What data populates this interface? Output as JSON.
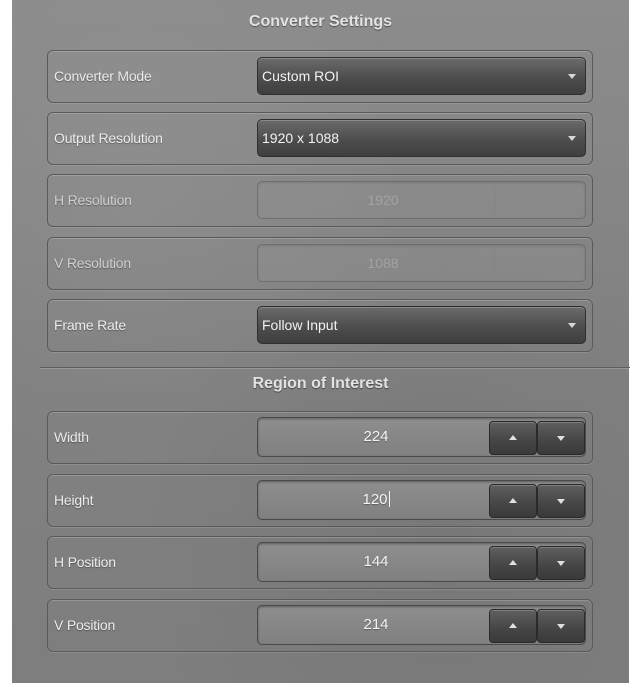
{
  "converter_settings": {
    "title": "Converter Settings",
    "converter_mode": {
      "label": "Converter Mode",
      "value": "Custom ROI"
    },
    "output_resolution": {
      "label": "Output Resolution",
      "value": "1920 x 1088"
    },
    "h_resolution": {
      "label": "H Resolution",
      "value": "1920"
    },
    "v_resolution": {
      "label": "V Resolution",
      "value": "1088"
    },
    "frame_rate": {
      "label": "Frame Rate",
      "value": "Follow Input"
    }
  },
  "region_of_interest": {
    "title": "Region of Interest",
    "width": {
      "label": "Width",
      "value": "224"
    },
    "height": {
      "label": "Height",
      "value": "120"
    },
    "h_position": {
      "label": "H Position",
      "value": "144"
    },
    "v_position": {
      "label": "V Position",
      "value": "214"
    }
  },
  "icons": {
    "dropdown": "chevron-down-icon",
    "step_up": "arrow-up-icon",
    "step_down": "arrow-down-icon"
  },
  "colors": {
    "panel_background": "#848484",
    "control_dark": "#4d4d4d",
    "label_text": "#ececec",
    "disabled_value": "#a2a2a2"
  }
}
